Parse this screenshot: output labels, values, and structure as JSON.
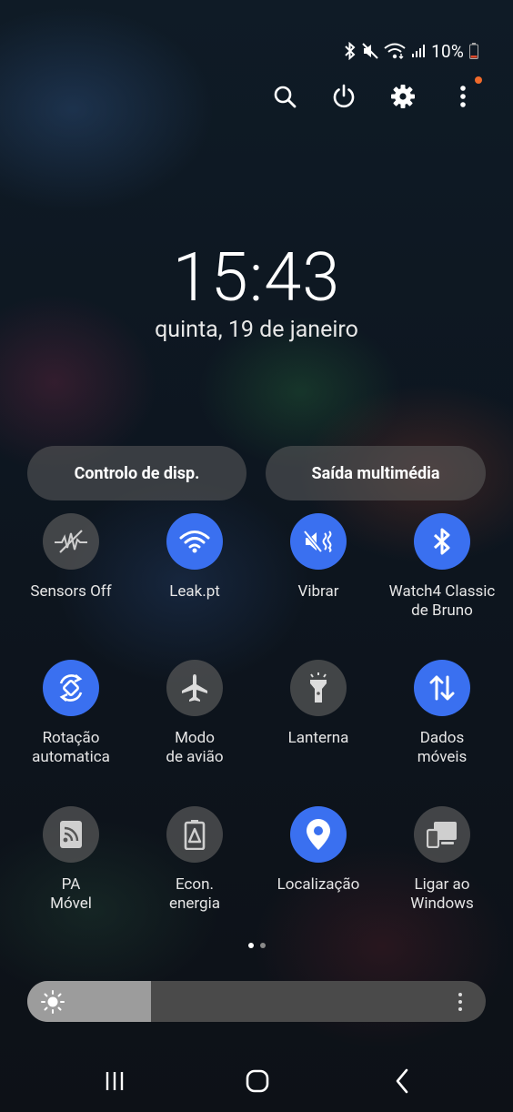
{
  "status_bar": {
    "battery_text": "10%",
    "icons": [
      "bluetooth-icon",
      "mute-icon",
      "wifi-icon",
      "signal-icon",
      "battery-icon"
    ]
  },
  "top_actions": [
    "search-icon",
    "power-icon",
    "gear-icon",
    "more-vertical-icon"
  ],
  "clock": {
    "time": "15:43",
    "date": "quinta, 19 de janeiro"
  },
  "pills": {
    "device_control": "Controlo de disp.",
    "media_output": "Saída multimédia"
  },
  "tiles": [
    {
      "label": "Sensors Off",
      "icon": "sensors-off-icon",
      "active": false
    },
    {
      "label": "Leak.pt",
      "icon": "wifi-icon",
      "active": true
    },
    {
      "label": "Vibrar",
      "icon": "vibrate-icon",
      "active": true
    },
    {
      "label": "Watch4 Classic\nde Bruno",
      "icon": "bluetooth-icon",
      "active": true
    },
    {
      "label": "Rotação\nautomatica",
      "icon": "auto-rotate-icon",
      "active": true
    },
    {
      "label": "Modo\nde avião",
      "icon": "airplane-icon",
      "active": false
    },
    {
      "label": "Lanterna",
      "icon": "flashlight-icon",
      "active": false
    },
    {
      "label": "Dados\nmóveis",
      "icon": "mobile-data-icon",
      "active": true
    },
    {
      "label": "PA\nMóvel",
      "icon": "hotspot-icon",
      "active": false
    },
    {
      "label": "Econ.\nenergia",
      "icon": "power-saving-icon",
      "active": false
    },
    {
      "label": "Localização",
      "icon": "location-icon",
      "active": true
    },
    {
      "label": "Ligar ao\nWindows",
      "icon": "link-windows-icon",
      "active": false
    }
  ],
  "pager": {
    "pages": 2,
    "current": 1
  },
  "brightness": {
    "level": 0.27
  },
  "colors": {
    "accent": "#3a70f0",
    "tile_off": "#5a5a5a",
    "notification_dot": "#f06a2b"
  },
  "navbar": [
    "recents-icon",
    "home-icon",
    "back-icon"
  ]
}
